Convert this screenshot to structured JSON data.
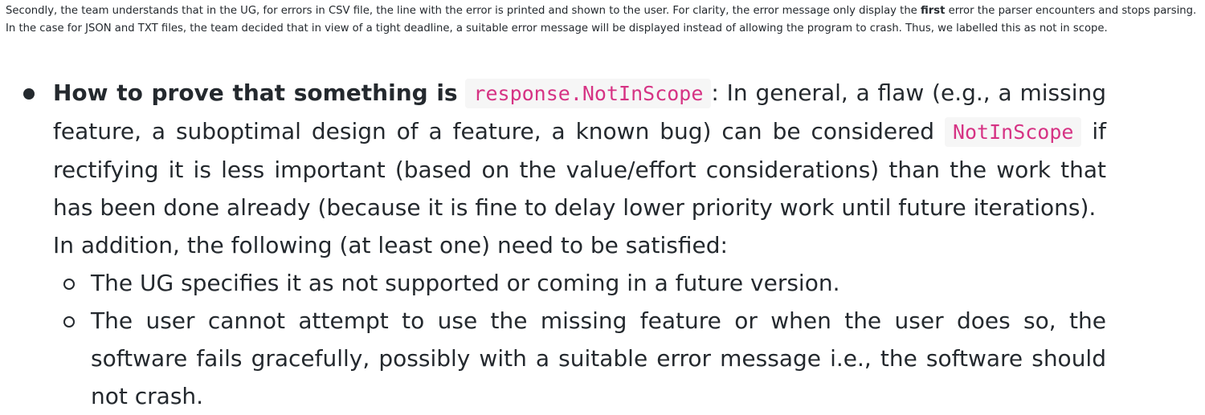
{
  "intro": {
    "text_before_bold": "Secondly, the team understands that in the UG, for errors in CSV file, the line with the error is printed and shown to the user. For clarity, the error message only display the ",
    "bold": "first",
    "text_after_bold": " error the parser encounters and stops parsing. In the case for JSON and TXT files, the team decided that in view of a tight deadline, a suitable error message will be displayed instead of allowing the program to crash. Thus, we labelled this as not in scope."
  },
  "bullet": {
    "lead": "How to prove that something is",
    "code_main": "response.NotInScope",
    "text_part1": ": In general, a flaw (e.g., a missing feature, a suboptimal design of a feature, a known bug) can be considered ",
    "code_inline": "NotInScope",
    "text_part2": " if rectifying it is less important (based on the value/effort considerations) than the work that has been done already (because it is fine to delay lower priority work until future iterations).",
    "addition": "In addition, the following (at least one) need to be satisfied:",
    "sub_items": [
      "The UG specifies it as not supported or coming in a future version.",
      "The user cannot attempt to use the missing feature or when the user does so, the software fails gracefully, possibly with a suitable error message i.e., the software should not crash."
    ]
  }
}
